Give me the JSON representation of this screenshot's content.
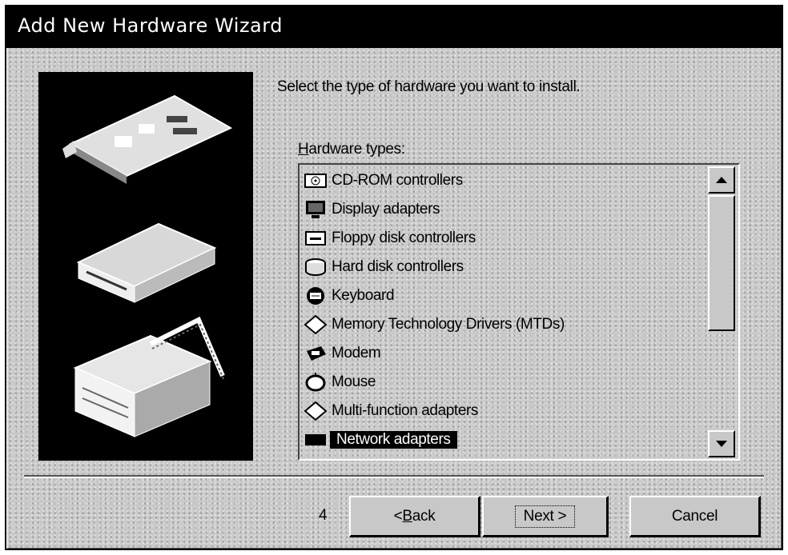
{
  "window": {
    "title": "Add New Hardware Wizard"
  },
  "prompt": "Select the type of hardware you want to install.",
  "hardware_types": {
    "label": "Hardware types:",
    "label_accel": "H",
    "label_rest": "ardware types:",
    "items": [
      {
        "label": "CD-ROM controllers",
        "icon": "cdrom-icon",
        "selected": false
      },
      {
        "label": "Display adapters",
        "icon": "monitor-icon",
        "selected": false
      },
      {
        "label": "Floppy disk controllers",
        "icon": "floppy-controller-icon",
        "selected": false
      },
      {
        "label": "Hard disk controllers",
        "icon": "hard-disk-icon",
        "selected": false
      },
      {
        "label": "Keyboard",
        "icon": "keyboard-icon",
        "selected": false
      },
      {
        "label": "Memory Technology Drivers (MTDs)",
        "icon": "memory-card-icon",
        "selected": false
      },
      {
        "label": "Modem",
        "icon": "modem-icon",
        "selected": false
      },
      {
        "label": "Mouse",
        "icon": "mouse-icon",
        "selected": false
      },
      {
        "label": "Multi-function adapters",
        "icon": "multifunction-adapter-icon",
        "selected": false
      },
      {
        "label": "Network adapters",
        "icon": "network-adapter-icon",
        "selected": true
      }
    ]
  },
  "buttons": {
    "back_accel": "B",
    "back_pre": "< ",
    "back_rest": "ack",
    "next": "Next >",
    "cancel": "Cancel"
  },
  "fragment": "4"
}
